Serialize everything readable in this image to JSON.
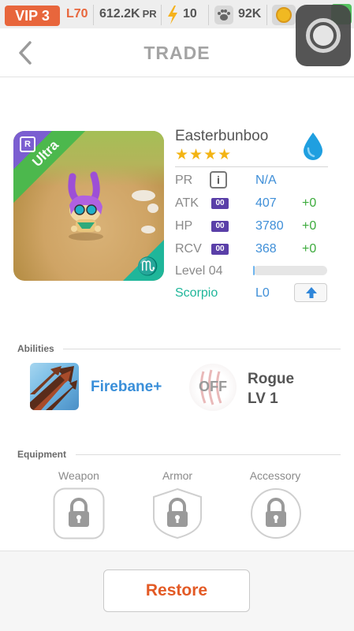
{
  "status_bar": {
    "vip_label": "VIP 3",
    "player_level": "L70",
    "power_rating_value": "612.2K",
    "power_rating_unit": "PR",
    "energy": "10",
    "paw_currency": "92K"
  },
  "header": {
    "title": "TRADE"
  },
  "monster": {
    "name": "Easterbunboo",
    "rarity": "Ultra",
    "rarity_badge": "R",
    "stars": "★★★★",
    "star_count": 4,
    "element_icon": "water-drop-icon",
    "zodiac_glyph": "♏",
    "stats": {
      "pr_label": "PR",
      "pr_info_glyph": "i",
      "pr_value": "N/A",
      "atk_label": "ATK",
      "atk_tag": "00",
      "atk_value": "407",
      "atk_bonus": "+0",
      "hp_label": "HP",
      "hp_tag": "00",
      "hp_value": "3780",
      "hp_bonus": "+0",
      "rcv_label": "RCV",
      "rcv_tag": "00",
      "rcv_value": "368",
      "rcv_bonus": "+0"
    },
    "level_label": "Level 04",
    "level_progress": 0.02,
    "zodiac_name": "Scorpio",
    "zodiac_level": "L0"
  },
  "abilities": {
    "section_title": "Abilities",
    "ability_name": "Firebane+",
    "skill_state": "OFF",
    "skill_name": "Rogue",
    "skill_level": "LV 1"
  },
  "equipment": {
    "section_title": "Equipment",
    "slots": [
      {
        "label": "Weapon"
      },
      {
        "label": "Armor"
      },
      {
        "label": "Accessory"
      }
    ]
  },
  "footer": {
    "restore_label": "Restore"
  },
  "colors": {
    "accent_orange": "#e8663c",
    "stat_blue": "#3f8fd8",
    "bonus_green": "#3cab3c",
    "zodiac_teal": "#1fb69a",
    "star_gold": "#f3b414",
    "rarity_purple": "#7b5ed1",
    "ultra_green": "#4cb84d"
  }
}
